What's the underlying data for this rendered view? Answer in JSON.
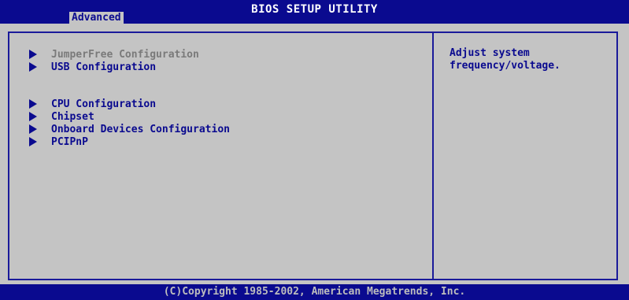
{
  "header": {
    "title": "BIOS SETUP UTILITY",
    "active_tab": "Advanced"
  },
  "menu": {
    "items": [
      {
        "label": "JumperFree Configuration",
        "selected": true
      },
      {
        "label": "USB Configuration",
        "selected": false
      },
      {
        "label": "CPU Configuration",
        "selected": false
      },
      {
        "label": "Chipset",
        "selected": false
      },
      {
        "label": "Onboard Devices Configuration",
        "selected": false
      },
      {
        "label": "PCIPnP",
        "selected": false
      }
    ]
  },
  "help": {
    "text": "Adjust system\nfrequency/voltage."
  },
  "footer": {
    "copyright": "(C)Copyright 1985-2002, American Megatrends, Inc."
  },
  "colors": {
    "bar_background": "#0a0a8f",
    "panel_background": "#c4c4c4",
    "text_primary": "#0a0a8f",
    "text_selected": "#7a7a7a",
    "footer_text": "#bdbdbd"
  }
}
